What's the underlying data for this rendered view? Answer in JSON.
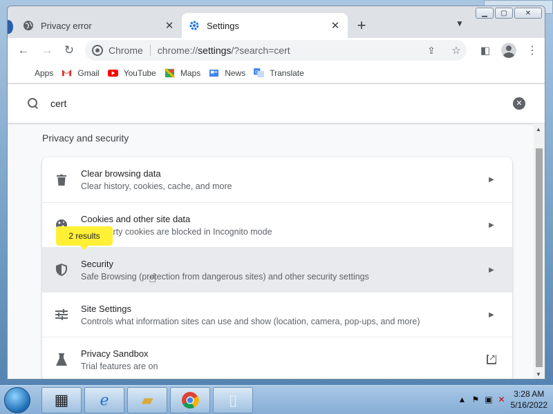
{
  "tabs": [
    {
      "title": "Privacy error",
      "active": false,
      "icon": "globe-icon"
    },
    {
      "title": "Settings",
      "active": true,
      "icon": "gear-icon"
    }
  ],
  "toolbar": {
    "omnibox_label": "Chrome",
    "url_prefix": "chrome://",
    "url_host": "settings",
    "url_suffix": "/?search=cert"
  },
  "bookmarks": [
    {
      "label": "Apps",
      "icon": "apps-grid-icon",
      "color": "#1a73e8"
    },
    {
      "label": "Gmail",
      "icon": "gmail-icon",
      "color": "#d93025"
    },
    {
      "label": "YouTube",
      "icon": "youtube-icon",
      "color": "#ff0000"
    },
    {
      "label": "Maps",
      "icon": "maps-icon",
      "color": "#34a853"
    },
    {
      "label": "News",
      "icon": "news-icon",
      "color": "#4285f4"
    },
    {
      "label": "Translate",
      "icon": "translate-icon",
      "color": "#4285f4"
    }
  ],
  "search": {
    "value": "cert"
  },
  "section": {
    "title": "Privacy and security"
  },
  "bubble": {
    "text": "2 results"
  },
  "rows": [
    {
      "title": "Clear browsing data",
      "subtitle": "Clear history, cookies, cache, and more",
      "icon": "trash-icon",
      "action": "arrow"
    },
    {
      "title": "Cookies and other site data",
      "subtitle": "Third-party cookies are blocked in Incognito mode",
      "icon": "cookie-icon",
      "action": "arrow"
    },
    {
      "title": "Security",
      "subtitle": "Safe Browsing (protection from dangerous sites) and other security settings",
      "icon": "shield-icon",
      "action": "arrow"
    },
    {
      "title": "Site Settings",
      "subtitle": "Controls what information sites can use and show (location, camera, pop-ups, and more)",
      "icon": "sliders-icon",
      "action": "arrow"
    },
    {
      "title": "Privacy Sandbox",
      "subtitle": "Trial features are on",
      "icon": "flask-icon",
      "action": "external"
    }
  ],
  "taskbar": {
    "time": "3:28 AM",
    "date": "5/16/2022"
  }
}
